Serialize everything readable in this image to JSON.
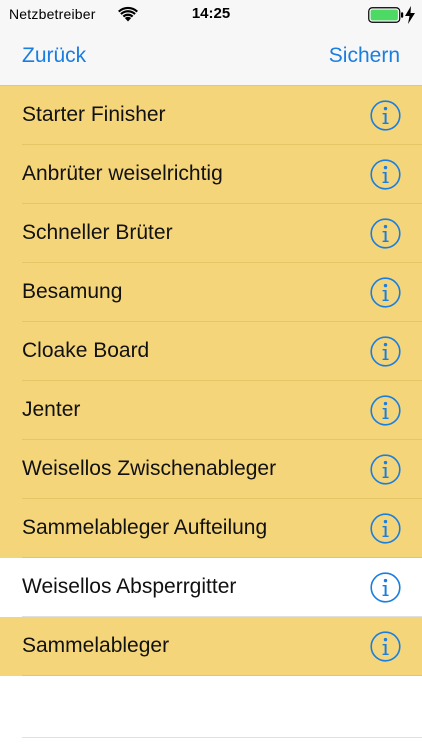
{
  "status_bar": {
    "carrier": "Netzbetreiber",
    "time": "14:25",
    "battery_color": "#4cd964"
  },
  "nav": {
    "back_label": "Zurück",
    "save_label": "Sichern",
    "tint_color": "#1a7ee0"
  },
  "colors": {
    "selected_row": "#f5d57a",
    "unselected_row": "#ffffff"
  },
  "list": {
    "items": [
      {
        "label": "Starter Finisher",
        "selected": true
      },
      {
        "label": "Anbrüter weiselrichtig",
        "selected": true
      },
      {
        "label": "Schneller Brüter",
        "selected": true
      },
      {
        "label": "Besamung",
        "selected": true
      },
      {
        "label": "Cloake Board",
        "selected": true
      },
      {
        "label": "Jenter",
        "selected": true
      },
      {
        "label": "Weisellos Zwischenableger",
        "selected": true
      },
      {
        "label": "Sammelableger Aufteilung",
        "selected": true
      },
      {
        "label": "Weisellos Absperrgitter",
        "selected": false
      },
      {
        "label": "Sammelableger",
        "selected": true
      }
    ]
  }
}
